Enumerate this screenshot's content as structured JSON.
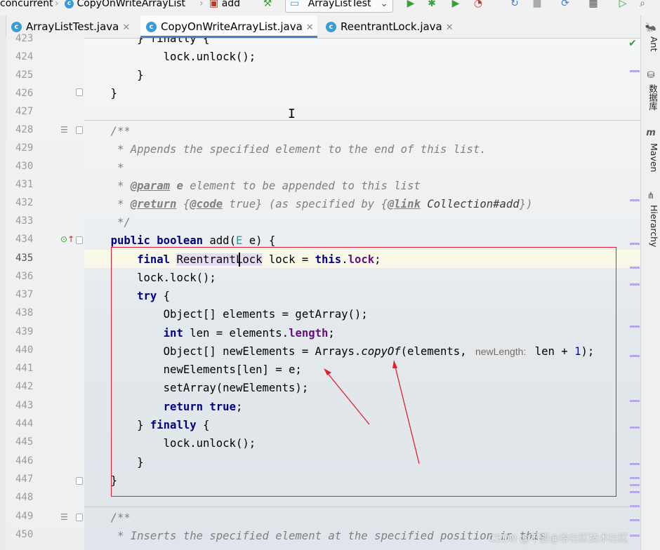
{
  "breadcrumb": [
    "concurrent",
    "CopyOnWriteArrayList",
    "add"
  ],
  "run_config": "ArrayListTest",
  "tabs": [
    {
      "label": "ArrayListTest.java"
    },
    {
      "label": "CopyOnWriteArrayList.java"
    },
    {
      "label": "ReentrantLock.java"
    }
  ],
  "right_tools": [
    "Ant",
    "数据库",
    "Maven",
    "Hierarchy"
  ],
  "line_numbers": [
    "423",
    "424",
    "425",
    "426",
    "427",
    "428",
    "429",
    "430",
    "431",
    "432",
    "433",
    "434",
    "435",
    "436",
    "437",
    "438",
    "439",
    "440",
    "441",
    "442",
    "443",
    "444",
    "445",
    "446",
    "447",
    "448",
    "449",
    "450"
  ],
  "code": {
    "l423": "        } finally {",
    "l424": "            lock.unlock();",
    "l425": "        }",
    "l426": "    }",
    "l428": "    /**",
    "l429": "     * Appends the specified element to the end of this list.",
    "l430": "     *",
    "l431_tag": "@param",
    "l431_name": "e",
    "l431_rest": " element to be appended to this list",
    "l432_tag": "@return",
    "l432_code": "@code",
    "l432_true": " true}",
    "l432_mid": " (as specified by {",
    "l432_link": "@link",
    "l432_ref": " Collection#add",
    "l433": "     */",
    "l434_public": "public",
    "l434_boolean": "boolean",
    "l434_sig": " add(",
    "l434_E": "E",
    "l434_end": " e) {",
    "l435_final": "final",
    "l435_type": "ReentrantLock",
    "l435_rest": " lock = ",
    "l435_this": "this",
    "l435_field": "lock",
    "l436": "lock.lock();",
    "l437_try": "try",
    "l438": "Object[] elements = getArray();",
    "l439_int": "int",
    "l439_rest": " len = elements.",
    "l439_field": "length",
    "l440_a": "Object[] newElements = Arrays.",
    "l440_method": "copyOf",
    "l440_b": "(elements, ",
    "l440_hint": "newLength:",
    "l440_c": " len + ",
    "l440_num": "1",
    "l440_d": ");",
    "l441": "newElements[len] = e;",
    "l442": "setArray(newElements);",
    "l443_return": "return",
    "l443_true": "true",
    "l444_finally": "finally",
    "l445": "lock.unlock();",
    "l446": "}",
    "l447": "}",
    "l449": "    /**",
    "l450": "     * Inserts the specified element at the specified position in this"
  },
  "watermark": "CSDN @不要@给社区技术社区",
  "colors": {
    "keyword": "#000080",
    "comment": "#808080",
    "field": "#660e7a",
    "annotation_box": "#e0202e",
    "tab_underline": "#4083c9",
    "run_green": "#3aa03a"
  }
}
